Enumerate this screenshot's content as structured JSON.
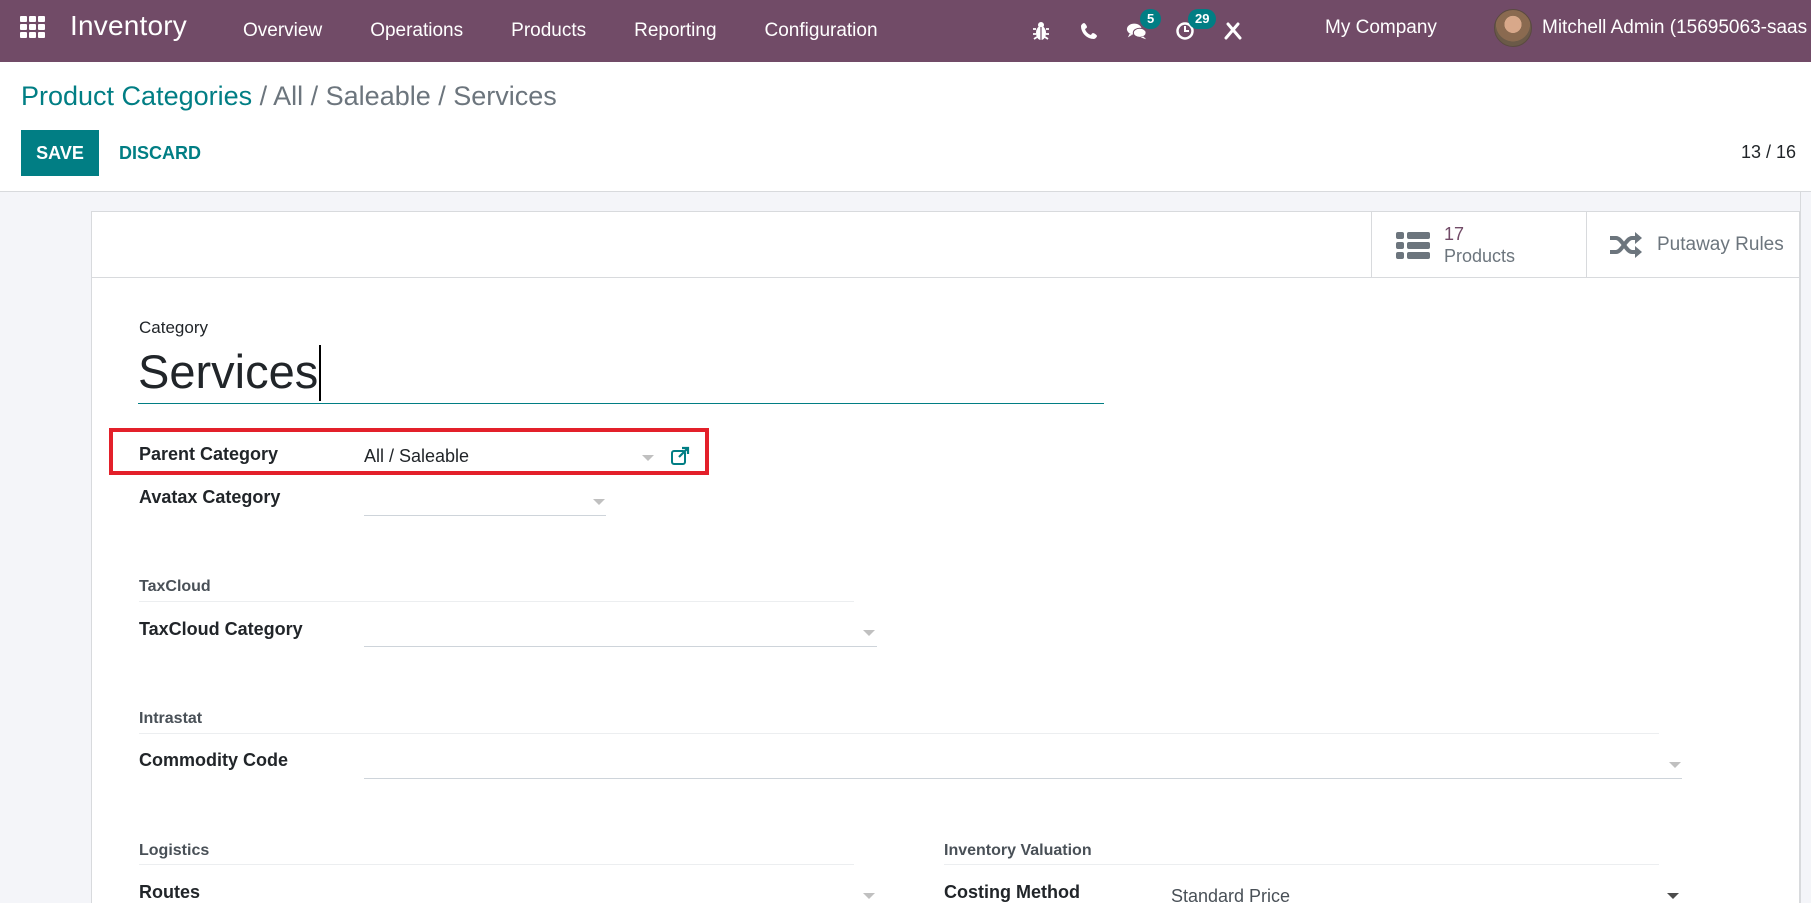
{
  "navbar": {
    "app_name": "Inventory",
    "menu": [
      "Overview",
      "Operations",
      "Products",
      "Reporting",
      "Configuration"
    ],
    "systray": {
      "messages_badge": "5",
      "activities_badge": "29"
    },
    "company": "My Company",
    "user": "Mitchell Admin (15695063-saas"
  },
  "breadcrumb": {
    "root": "Product Categories",
    "rest": " / All / Saleable / Services"
  },
  "actions": {
    "save_label": "SAVE",
    "discard_label": "DISCARD"
  },
  "pager": "13 / 16",
  "button_box": {
    "products_count": "17",
    "products_label": "Products",
    "putaway_label": "Putaway Rules"
  },
  "form": {
    "category_label": "Category",
    "category_value": "Services",
    "parent_category_label": "Parent Category",
    "parent_category_value": "All / Saleable",
    "avatax_category_label": "Avatax Category",
    "avatax_category_value": "",
    "taxcloud_group": "TaxCloud",
    "taxcloud_category_label": "TaxCloud Category",
    "taxcloud_category_value": "",
    "intrastat_group": "Intrastat",
    "commodity_code_label": "Commodity Code",
    "commodity_code_value": "",
    "logistics_group": "Logistics",
    "routes_label": "Routes",
    "routes_value": "",
    "inventory_valuation_group": "Inventory Valuation",
    "costing_method_label": "Costing Method",
    "costing_method_value": "Standard Price"
  },
  "colors": {
    "brand": "#714b67",
    "primary": "#017e84",
    "highlight": "#e3202a"
  }
}
